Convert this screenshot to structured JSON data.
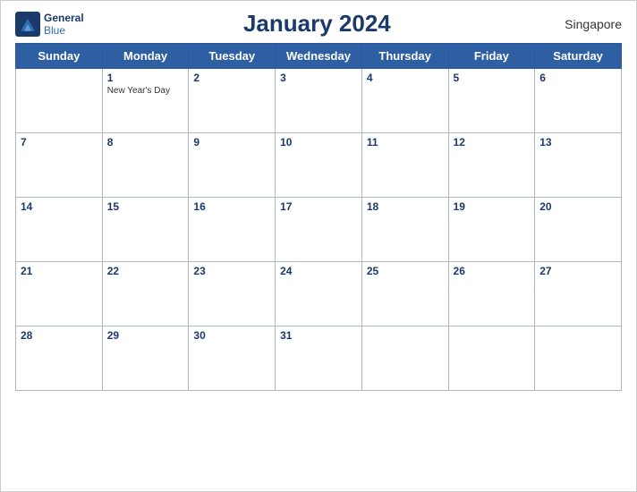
{
  "header": {
    "logo_line1": "General",
    "logo_line2": "Blue",
    "title": "January 2024",
    "country": "Singapore"
  },
  "days_of_week": [
    "Sunday",
    "Monday",
    "Tuesday",
    "Wednesday",
    "Thursday",
    "Friday",
    "Saturday"
  ],
  "weeks": [
    [
      {
        "day": "",
        "empty": true
      },
      {
        "day": "1",
        "holiday": "New Year's Day"
      },
      {
        "day": "2"
      },
      {
        "day": "3"
      },
      {
        "day": "4"
      },
      {
        "day": "5"
      },
      {
        "day": "6"
      }
    ],
    [
      {
        "day": "7"
      },
      {
        "day": "8"
      },
      {
        "day": "9"
      },
      {
        "day": "10"
      },
      {
        "day": "11"
      },
      {
        "day": "12"
      },
      {
        "day": "13"
      }
    ],
    [
      {
        "day": "14"
      },
      {
        "day": "15"
      },
      {
        "day": "16"
      },
      {
        "day": "17"
      },
      {
        "day": "18"
      },
      {
        "day": "19"
      },
      {
        "day": "20"
      }
    ],
    [
      {
        "day": "21"
      },
      {
        "day": "22"
      },
      {
        "day": "23"
      },
      {
        "day": "24"
      },
      {
        "day": "25"
      },
      {
        "day": "26"
      },
      {
        "day": "27"
      }
    ],
    [
      {
        "day": "28"
      },
      {
        "day": "29"
      },
      {
        "day": "30"
      },
      {
        "day": "31"
      },
      {
        "day": "",
        "empty": true
      },
      {
        "day": "",
        "empty": true
      },
      {
        "day": "",
        "empty": true
      }
    ]
  ]
}
